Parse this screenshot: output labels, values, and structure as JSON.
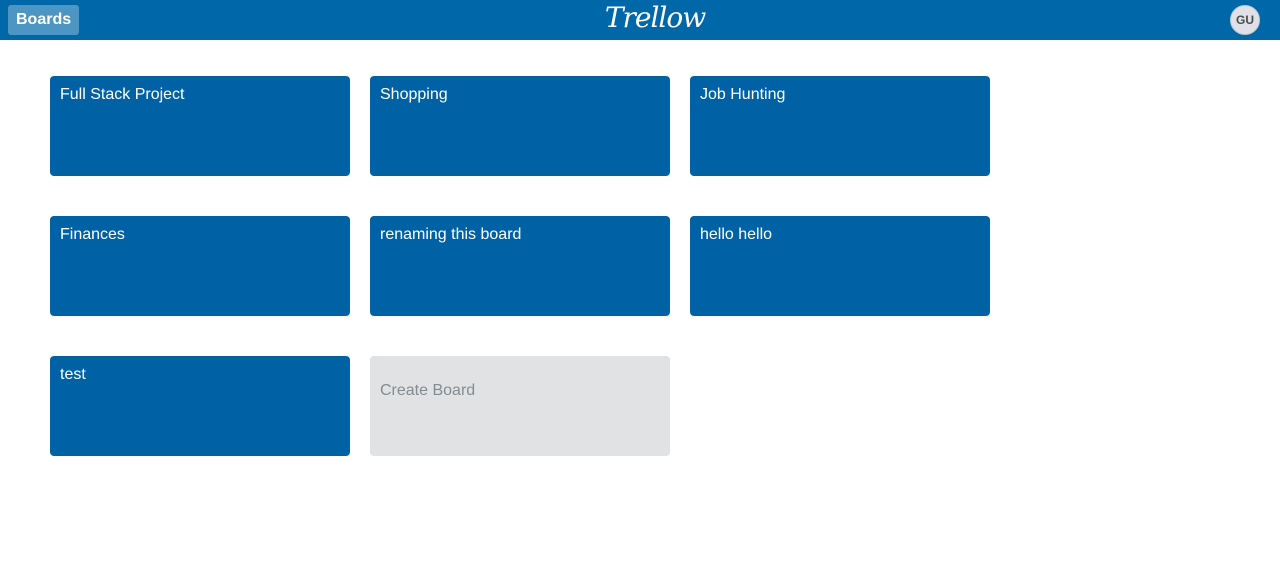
{
  "topbar": {
    "boards_label": "Boards",
    "logo_text": "Trellow",
    "avatar_initials": "GU",
    "bar_color": "#0067a8",
    "logo-icon": "script-wordmark"
  },
  "boards": [
    {
      "title": "Full Stack Project"
    },
    {
      "title": "Shopping"
    },
    {
      "title": "Job Hunting"
    },
    {
      "title": "Finances"
    },
    {
      "title": "renaming this board"
    },
    {
      "title": "hello hello"
    },
    {
      "title": "test"
    }
  ],
  "create_board": {
    "label": "Create Board"
  },
  "colors": {
    "tile": "#0062a5",
    "create_tile": "#e1e2e4",
    "create_text": "#838c91"
  }
}
